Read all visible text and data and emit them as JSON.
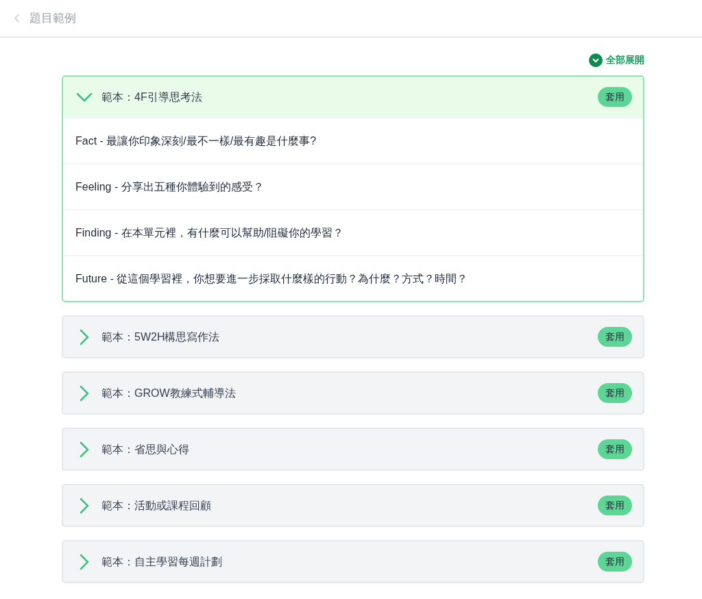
{
  "header": {
    "back_icon": "‹",
    "title": "題目範例"
  },
  "expand_all": {
    "label": "全部展開"
  },
  "templates": [
    {
      "title": "範本：4F引導思考法",
      "expanded": true,
      "apply": "套用",
      "questions": [
        "Fact - 最讓你印象深刻/最不一樣/最有趣是什麼事?",
        "Feeling - 分享出五種你體驗到的感受？",
        "Finding - 在本單元裡，有什麼可以幫助/阻礙你的學習？",
        "Future - 從這個學習裡，你想要進一步採取什麼樣的行動？為什麼？方式？時間？"
      ]
    },
    {
      "title": "範本：5W2H構思寫作法",
      "expanded": false,
      "apply": "套用"
    },
    {
      "title": "範本：GROW教練式輔導法",
      "expanded": false,
      "apply": "套用"
    },
    {
      "title": "範本：省思與心得",
      "expanded": false,
      "apply": "套用"
    },
    {
      "title": "範本：活動或課程回顧",
      "expanded": false,
      "apply": "套用"
    },
    {
      "title": "範本：自主學習每週計劃",
      "expanded": false,
      "apply": "套用"
    }
  ]
}
